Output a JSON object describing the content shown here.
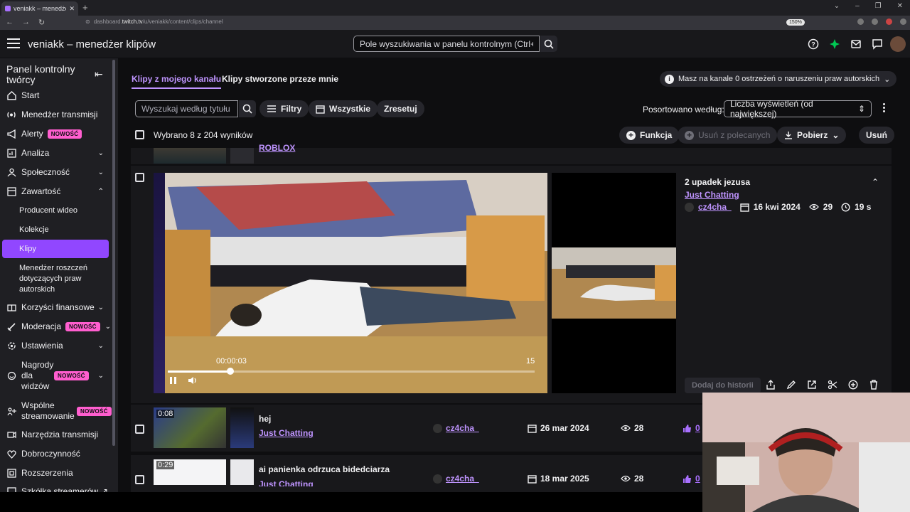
{
  "browser": {
    "tab_title": "veniakk – menedżer klipów",
    "url_prefix": "dashboard.",
    "url_domain": "twitch.tv",
    "url_path": "/u/veniakk/content/clips/channel",
    "zoom": "150%"
  },
  "header": {
    "title": "veniakk – menedżer klipów",
    "search_placeholder": "Pole wyszukiwania w panelu kontrolnym (Ctrl+/)"
  },
  "sidebar": {
    "title": "Panel kontrolny twórcy",
    "items": [
      {
        "label": "Start",
        "icon": "home-icon"
      },
      {
        "label": "Menedżer transmisji",
        "icon": "broadcast-icon"
      },
      {
        "label": "Alerty",
        "icon": "megaphone-icon",
        "badge": "NOWOŚĆ"
      },
      {
        "label": "Analiza",
        "icon": "analytics-icon"
      },
      {
        "label": "Społeczność",
        "icon": "community-icon"
      },
      {
        "label": "Zawartość",
        "icon": "content-icon"
      },
      {
        "label": "Korzyści finansowe",
        "icon": "monetization-icon"
      },
      {
        "label": "Moderacja",
        "icon": "sword-icon",
        "badge": "NOWOŚĆ"
      },
      {
        "label": "Ustawienia",
        "icon": "gear-icon"
      },
      {
        "label": "Nagrody dla widzów",
        "icon": "rewards-icon",
        "badge": "NOWOŚĆ"
      },
      {
        "label": "Wspólne streamowanie",
        "icon": "collab-icon",
        "badge": "NOWOŚĆ"
      },
      {
        "label": "Narzędzia transmisji",
        "icon": "camera-icon"
      },
      {
        "label": "Dobroczynność",
        "icon": "charity-icon"
      },
      {
        "label": "Rozszerzenia",
        "icon": "extensions-icon"
      },
      {
        "label": "Szkółka streamerów",
        "icon": "external-link-icon"
      }
    ],
    "sub_items": [
      "Producent wideo",
      "Kolekcje",
      "Klipy",
      "Menedżer roszczeń dotyczących praw autorskich"
    ]
  },
  "main": {
    "tabs": [
      "Klipy z mojego kanału",
      "Klipy stworzone przeze mnie"
    ],
    "copyright_notice": "Masz na kanale 0 ostrzeżeń o naruszeniu praw autorskich",
    "filter_placeholder": "Wyszukaj według tytułu lu",
    "filters_label": "Filtry",
    "all_label": "Wszystkie",
    "reset_label": "Zresetuj",
    "sort_label": "Posortowano według:",
    "sort_value": "Liczba wyświetleń (od największej)",
    "selection_text": "Wybrano 8 z 204 wyników",
    "bulk_actions": {
      "feature": "Funkcja",
      "remove_featured": "Usuń z polecanych",
      "download": "Pobierz",
      "delete": "Usuń"
    }
  },
  "clips": {
    "previous_category": "ROBLOX",
    "expanded": {
      "title": "2 upadek jezusa",
      "category": "Just Chatting",
      "author": "cz4cha_",
      "date": "16 kwi 2024",
      "views": "29",
      "duration": "19 s",
      "player_time": "00:00:03",
      "player_fps": "15",
      "progress": 0.17,
      "add_history": "Dodaj do historii"
    },
    "rows": [
      {
        "duration": "0:08",
        "title": "hej",
        "category": "Just Chatting",
        "author": "cz4cha_",
        "date": "26 mar 2024",
        "views": "28",
        "likes": "0"
      },
      {
        "duration": "0:29",
        "title": "ai panienka odrzuca bidedciarza",
        "category": "Just Chatting",
        "author": "cz4cha_",
        "date": "18 mar 2025",
        "views": "28",
        "likes": "0"
      }
    ]
  },
  "colors": {
    "accent": "#9147ff",
    "link": "#bf94ff",
    "badge": "#ff5ecf"
  }
}
